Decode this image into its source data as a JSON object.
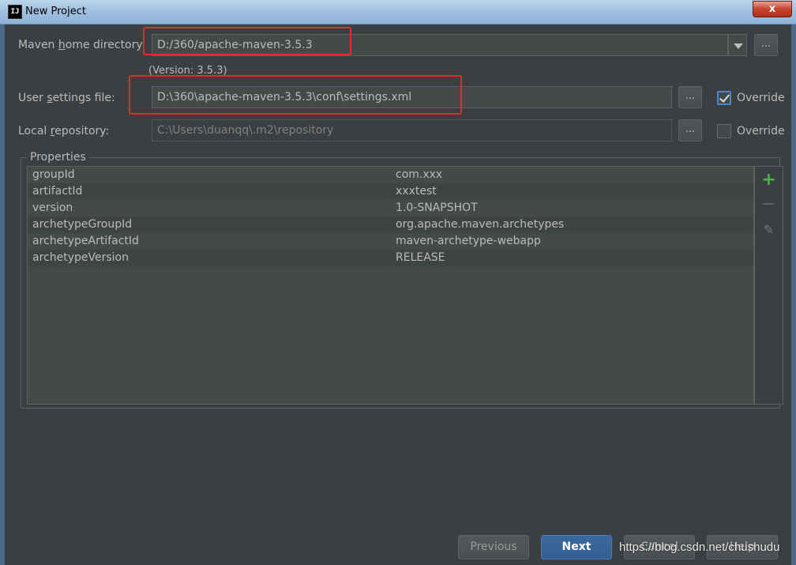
{
  "window": {
    "title": "New Project",
    "close_label": "x",
    "app_icon_text": "IJ"
  },
  "maven_home": {
    "label_pre": "Maven ",
    "label_mnemonic": "h",
    "label_post": "ome directory:",
    "value": "D:/360/apache-maven-3.5.3",
    "version_text": "(Version: 3.5.3)",
    "browse_label": "..."
  },
  "user_settings": {
    "label_pre": "User ",
    "label_mnemonic": "s",
    "label_post": "ettings file:",
    "value": "D:\\360\\apache-maven-3.5.3\\conf\\settings.xml",
    "browse_label": "...",
    "override_label": "Override",
    "override_checked": true
  },
  "local_repository": {
    "label_pre": "Local ",
    "label_mnemonic": "r",
    "label_post": "epository:",
    "value": "C:\\Users\\duanqq\\.m2\\repository",
    "browse_label": "...",
    "override_label": "Override",
    "override_checked": false
  },
  "properties": {
    "title": "Properties",
    "rows": [
      {
        "key": "groupId",
        "value": "com.xxx"
      },
      {
        "key": "artifactId",
        "value": "xxxtest"
      },
      {
        "key": "version",
        "value": "1.0-SNAPSHOT"
      },
      {
        "key": "archetypeGroupId",
        "value": "org.apache.maven.archetypes"
      },
      {
        "key": "archetypeArtifactId",
        "value": "maven-archetype-webapp"
      },
      {
        "key": "archetypeVersion",
        "value": "RELEASE"
      }
    ],
    "toolbar": {
      "add_icon": "plus-icon",
      "remove_icon": "minus-icon",
      "edit_icon": "pencil-icon"
    }
  },
  "footer": {
    "previous_label": "Previous",
    "next_label": "Next",
    "cancel_label": "Cancel",
    "help_label": "Help"
  },
  "watermark": "https://blog.csdn.net/chushudu",
  "colors": {
    "background": "#3c3f41",
    "accent": "#3b6aa0",
    "highlight_box": "#e22b2b",
    "add_icon": "#4ab04a"
  }
}
